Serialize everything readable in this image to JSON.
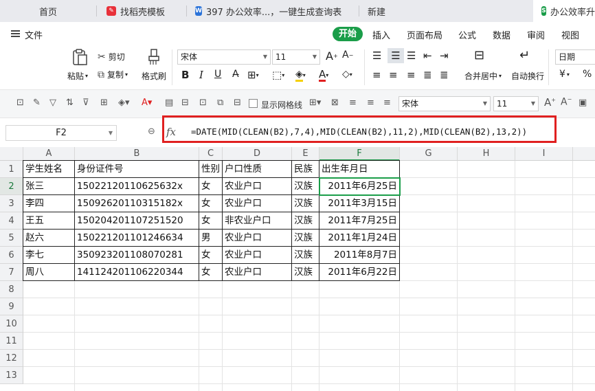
{
  "tabs": [
    {
      "label": "首页"
    },
    {
      "label": "找稻壳模板"
    },
    {
      "label": "397 办公效率...，一键生成查询表"
    },
    {
      "label": "新建"
    },
    {
      "label": "办公效率升"
    }
  ],
  "menu": {
    "file": "文件",
    "start": "开始",
    "items": [
      "插入",
      "页面布局",
      "公式",
      "数据",
      "审阅",
      "视图"
    ]
  },
  "ribbon": {
    "paste": "粘贴",
    "cut": "剪切",
    "copy": "复制",
    "format_painter": "格式刷",
    "font_name": "宋体",
    "font_size": "11",
    "merge_center": "合并居中",
    "wrap_text": "自动换行",
    "number_format": "日期",
    "currency": "¥",
    "percent": "%"
  },
  "toolbar2": {
    "show_gridlines": "显示网格线",
    "font_name": "宋体",
    "font_size": "11"
  },
  "formula_bar": {
    "name_box": "F2",
    "fx_label": "fx",
    "formula": "=DATE(MID(CLEAN(B2),7,4),MID(CLEAN(B2),11,2),MID(CLEAN(B2),13,2))"
  },
  "columns": [
    "A",
    "B",
    "C",
    "D",
    "E",
    "F",
    "G",
    "H",
    "I"
  ],
  "rows": [
    "1",
    "2",
    "3",
    "4",
    "5",
    "6",
    "7",
    "8",
    "9",
    "10",
    "11",
    "12",
    "13"
  ],
  "sheet": {
    "header": [
      "学生姓名",
      "身份证件号",
      "性别",
      "户口性质",
      "民族",
      "出生年月日"
    ],
    "data": [
      [
        "张三",
        "1502212011062563 2x",
        "女",
        "农业户口",
        "汉族",
        "2011年6月25日"
      ],
      [
        "李四",
        "150926201103151 82x",
        "女",
        "农业户口",
        "汉族",
        "2011年3月15日"
      ],
      [
        "王五",
        "150204201107251520",
        "女",
        "非农业户口",
        "汉族",
        "2011年7月25日"
      ],
      [
        "赵六",
        "150221201101246634",
        "男",
        "农业户口",
        "汉族",
        "2011年1月24日"
      ],
      [
        "李七",
        "350923201108070281",
        "女",
        "农业户口",
        "汉族",
        "2011年8月7日"
      ],
      [
        "周八",
        "141124201106220344",
        "女",
        "农业户口",
        "汉族",
        "2011年6月22日"
      ]
    ]
  },
  "active_cell": "F2"
}
